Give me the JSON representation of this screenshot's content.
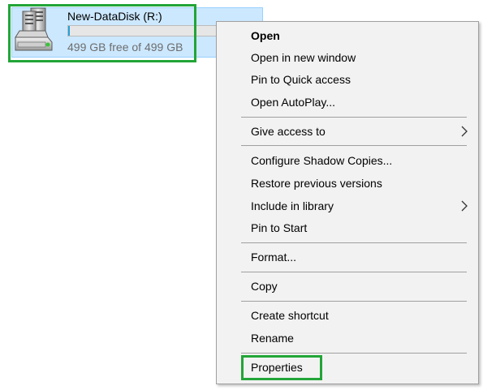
{
  "drive": {
    "name": "New-DataDisk (R:)",
    "free_text": "499 GB free of 499 GB",
    "used_fraction": 0.01,
    "icon": "hard-drive-icon",
    "selection_color": "#cce8ff",
    "highlight_color": "#22a538"
  },
  "context_menu": {
    "items": [
      {
        "label": "Open",
        "bold": true
      },
      {
        "label": "Open in new window"
      },
      {
        "label": "Pin to Quick access"
      },
      {
        "label": "Open AutoPlay..."
      },
      {
        "label": "Give access to",
        "submenu": true,
        "icon": "chevron-right-icon"
      },
      {
        "label": "Configure Shadow Copies..."
      },
      {
        "label": "Restore previous versions"
      },
      {
        "label": "Include in library",
        "submenu": true,
        "icon": "chevron-right-icon"
      },
      {
        "label": "Pin to Start"
      },
      {
        "label": "Format..."
      },
      {
        "label": "Copy"
      },
      {
        "label": "Create shortcut"
      },
      {
        "label": "Rename"
      },
      {
        "label": "Properties",
        "highlighted": true
      }
    ],
    "background": "#f2f2f2",
    "highlight_color": "#22a538"
  }
}
